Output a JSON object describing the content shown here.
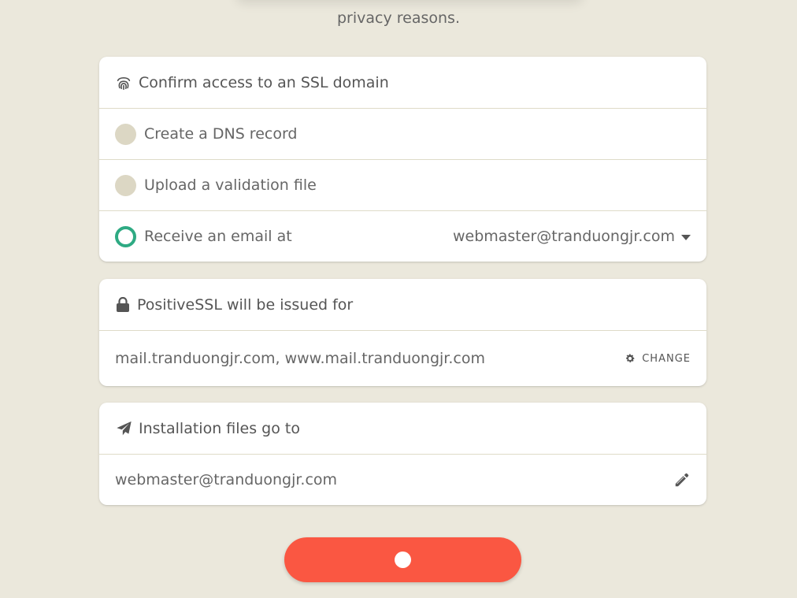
{
  "intro": {
    "text": "privacy reasons."
  },
  "confirm_card": {
    "title": "Confirm access to an SSL domain",
    "title_icon": "fingerprint-icon",
    "options": [
      {
        "label": "Create a DNS record",
        "selected": false
      },
      {
        "label": "Upload a validation file",
        "selected": false
      },
      {
        "label": "Receive an email at",
        "selected": true
      }
    ],
    "email_select_value": "webmaster@tranduongjr.com"
  },
  "issue_card": {
    "title": "PositiveSSL will be issued for",
    "title_icon": "lock-icon",
    "domains": "mail.tranduongjr.com, www.mail.tranduongjr.com",
    "change_label": "CHANGE"
  },
  "install_card": {
    "title": "Installation files go to",
    "title_icon": "paper-plane-icon",
    "email": "webmaster@tranduongjr.com"
  },
  "submit": {
    "state": "loading"
  },
  "colors": {
    "background": "#ebe8dc",
    "accent_green": "#2eaa83",
    "button_red": "#fa5742",
    "radio_idle": "#dcd7c4"
  }
}
